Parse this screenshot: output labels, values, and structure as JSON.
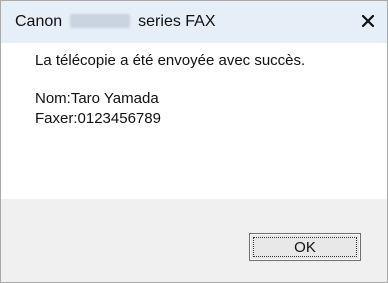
{
  "window": {
    "title_prefix": "Canon",
    "title_suffix": "series FAX",
    "close_icon": "close-icon"
  },
  "body": {
    "message": "La télécopie a été envoyée avec succès.",
    "name_line": "Nom:Taro Yamada",
    "fax_line": "Faxer:0123456789"
  },
  "footer": {
    "ok_label": "OK"
  }
}
